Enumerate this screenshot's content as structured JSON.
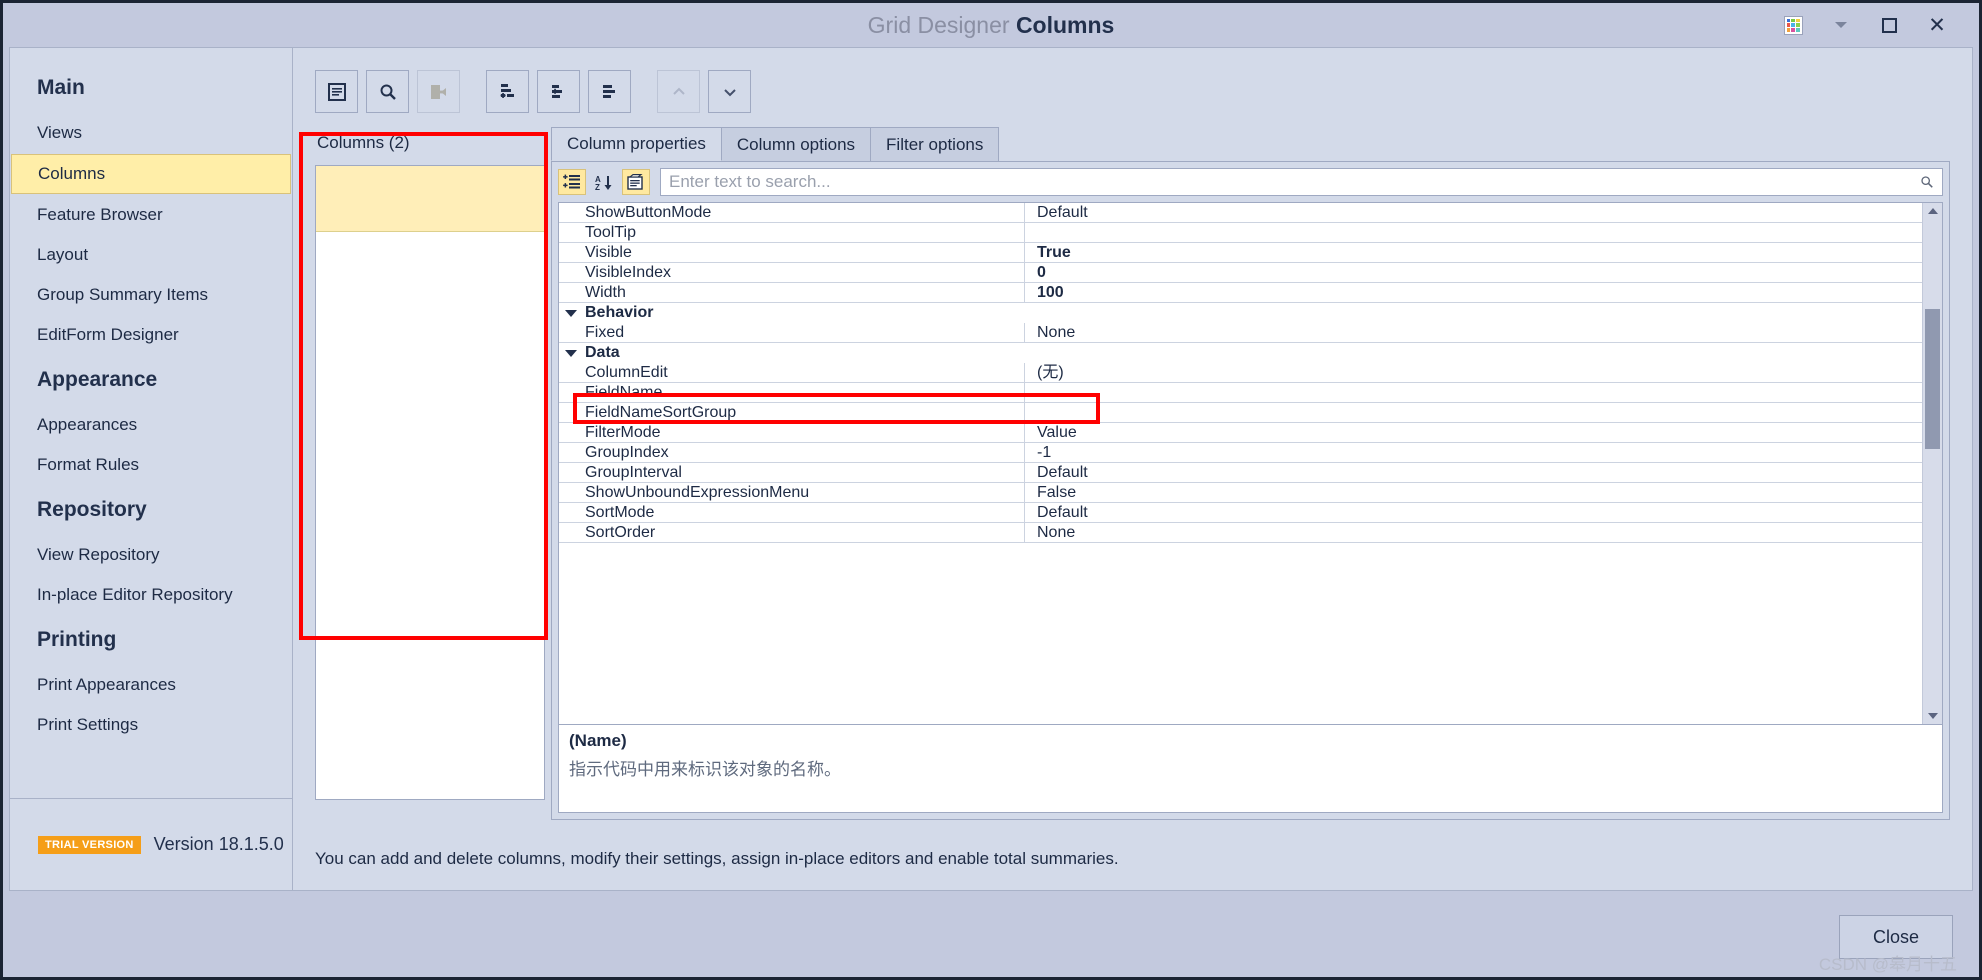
{
  "window": {
    "title_prefix": "Grid Designer",
    "title_main": "Columns",
    "controls": {
      "skin": "skin-grid-icon",
      "dropdown": "chevron-down-icon",
      "maximize": "maximize-icon",
      "close": "✕"
    }
  },
  "sidebar": {
    "groups": [
      {
        "label": "Main",
        "items": [
          "Views",
          "Columns",
          "Feature Browser",
          "Layout",
          "Group Summary Items",
          "EditForm Designer"
        ]
      },
      {
        "label": "Appearance",
        "items": [
          "Appearances",
          "Format Rules"
        ]
      },
      {
        "label": "Repository",
        "items": [
          "View Repository",
          "In-place Editor Repository"
        ]
      },
      {
        "label": "Printing",
        "items": [
          "Print Appearances",
          "Print Settings"
        ]
      }
    ],
    "selected": "Columns",
    "footer": {
      "badge": "TRIAL VERSION",
      "version": "Version 18.1.5.0"
    }
  },
  "toolbar": {
    "buttons": [
      {
        "name": "show-designer-button",
        "icon": "form-icon",
        "enabled": true
      },
      {
        "name": "search-button",
        "icon": "magnifier-icon",
        "enabled": true
      },
      {
        "name": "retrieve-fields-button",
        "icon": "export-icon",
        "enabled": false
      },
      {
        "name": "add-column-button",
        "icon": "add-node-icon",
        "enabled": true
      },
      {
        "name": "add-child-button",
        "icon": "add-child-icon",
        "enabled": true
      },
      {
        "name": "delete-column-button",
        "icon": "remove-node-icon",
        "enabled": true
      },
      {
        "name": "move-up-button",
        "icon": "chevron-up-icon",
        "enabled": false
      },
      {
        "name": "move-down-button",
        "icon": "chevron-down-icon",
        "enabled": true
      }
    ]
  },
  "columns_panel": {
    "label": "Columns (2)",
    "items": [
      {
        "label": ""
      }
    ]
  },
  "tabs": [
    {
      "label": "Column properties",
      "active": true
    },
    {
      "label": "Column options",
      "active": false
    },
    {
      "label": "Filter options",
      "active": false
    }
  ],
  "search": {
    "placeholder": "Enter text to search...",
    "value": "",
    "icons": [
      {
        "name": "categorized-icon",
        "active": true
      },
      {
        "name": "alphabetical-icon",
        "active": false
      },
      {
        "name": "description-icon",
        "active": true
      }
    ]
  },
  "property_grid": {
    "rows": [
      {
        "type": "prop",
        "name": "ShowButtonMode",
        "value": "Default",
        "bold": false
      },
      {
        "type": "prop",
        "name": "ToolTip",
        "value": "",
        "bold": false
      },
      {
        "type": "prop",
        "name": "Visible",
        "value": "True",
        "bold": true
      },
      {
        "type": "prop",
        "name": "VisibleIndex",
        "value": "0",
        "bold": true
      },
      {
        "type": "prop",
        "name": "Width",
        "value": "100",
        "bold": true
      },
      {
        "type": "cat",
        "name": "Behavior",
        "value": "",
        "bold": false
      },
      {
        "type": "prop",
        "name": "Fixed",
        "value": "None",
        "bold": false
      },
      {
        "type": "cat",
        "name": "Data",
        "value": "",
        "bold": false
      },
      {
        "type": "prop",
        "name": "ColumnEdit",
        "value": "(无)",
        "bold": false
      },
      {
        "type": "prop",
        "name": "FieldName",
        "value": "",
        "bold": false
      },
      {
        "type": "prop",
        "name": "FieldNameSortGroup",
        "value": "",
        "bold": false
      },
      {
        "type": "prop",
        "name": "FilterMode",
        "value": "Value",
        "bold": false
      },
      {
        "type": "prop",
        "name": "GroupIndex",
        "value": "-1",
        "bold": false
      },
      {
        "type": "prop",
        "name": "GroupInterval",
        "value": "Default",
        "bold": false
      },
      {
        "type": "prop",
        "name": "ShowUnboundExpressionMenu",
        "value": "False",
        "bold": false
      },
      {
        "type": "prop",
        "name": "SortMode",
        "value": "Default",
        "bold": false
      },
      {
        "type": "prop",
        "name": "SortOrder",
        "value": "None",
        "bold": false
      }
    ]
  },
  "description": {
    "title": "(Name)",
    "text": "指示代码中用来标识该对象的名称。"
  },
  "hint": "You can add and delete columns, modify their settings, assign in-place editors and enable total summaries.",
  "footer": {
    "close_label": "Close",
    "watermark": "CSDN @皋月十五"
  },
  "colors": {
    "accent_selected": "#ffeea8",
    "annotation": "#ff0000",
    "trial_badge": "#f59e18",
    "window_bg": "#c3c9de",
    "panel_bg": "#d3dae9"
  }
}
